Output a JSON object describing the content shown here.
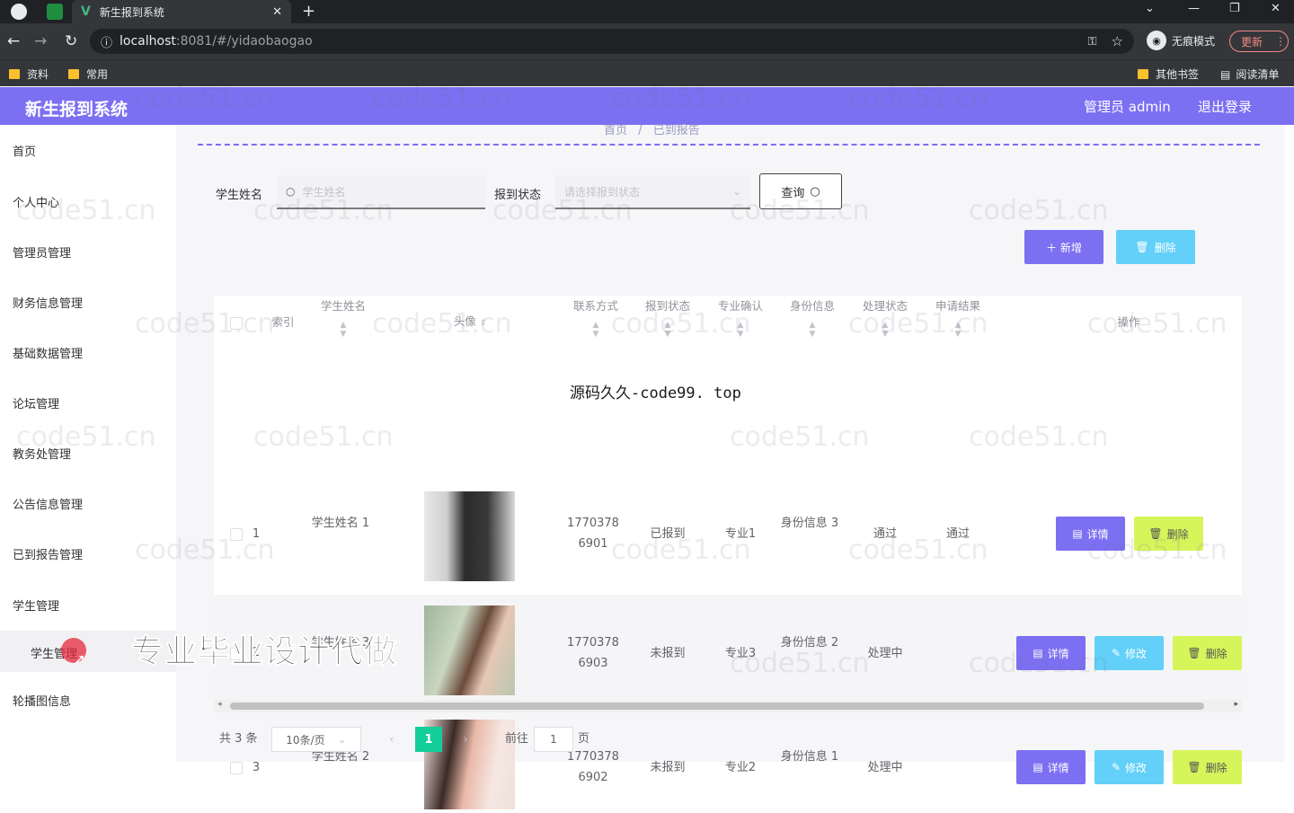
{
  "browser": {
    "tab_title": "新生报到系统",
    "tab_close": "✕",
    "new_tab": "+",
    "url_host": "localhost",
    "url_path": ":8081/#/yidaobaogao",
    "incognito_label": "无痕模式",
    "update_label": "更新",
    "bookmarks": [
      "资料",
      "常用"
    ],
    "other_bookmarks": "其他书签",
    "reading_list": "阅读清单"
  },
  "header": {
    "title": "新生报到系统",
    "user": "管理员 admin",
    "logout": "退出登录"
  },
  "sidebar": {
    "items": [
      "首页",
      "个人中心",
      "管理员管理",
      "财务信息管理",
      "基础数据管理",
      "论坛管理",
      "教务处管理",
      "公告信息管理",
      "已到报告管理",
      "学生管理"
    ],
    "submenu_active": "学生管理",
    "last_item": "轮播图信息"
  },
  "breadcrumb": {
    "home": "首页",
    "sep": "/",
    "current": "已到报告"
  },
  "search": {
    "name_label": "学生姓名",
    "name_placeholder": "学生姓名",
    "status_label": "报到状态",
    "status_placeholder": "请选择报到状态",
    "query_button": "查询"
  },
  "actions": {
    "add": "＋ 新增",
    "delete": "删除"
  },
  "table": {
    "headers": {
      "index": "索引",
      "name": "学生姓名",
      "avatar": "头像",
      "phone": "联系方式",
      "status": "报到状态",
      "major": "专业确认",
      "identity": "身份信息",
      "process": "处理状态",
      "result": "申请结果",
      "ops": "操作"
    },
    "rows": [
      {
        "index": "1",
        "name": "学生姓名 1",
        "phone": "1770378 6901",
        "status": "已报到",
        "major": "专业1",
        "identity": "身份信息 3",
        "process": "通过",
        "result": "通过"
      },
      {
        "index": "2",
        "name": "学生姓名 3",
        "phone": "1770378 6903",
        "status": "未报到",
        "major": "专业3",
        "identity": "身份信息 2",
        "process": "处理中",
        "result": ""
      },
      {
        "index": "3",
        "name": "学生姓名 2",
        "phone": "1770378 6902",
        "status": "未报到",
        "major": "专业2",
        "identity": "身份信息 1",
        "process": "处理中",
        "result": ""
      }
    ],
    "op_detail": "详情",
    "op_edit": "修改",
    "op_delete": "删除"
  },
  "pagination": {
    "total": "共 3 条",
    "page_size": "10条/页",
    "current_page": "1",
    "goto_prefix": "前往",
    "goto_value": "1",
    "goto_suffix": "页"
  },
  "overlays": {
    "source_text": "源码久久-code99. top",
    "promo_text": "专业毕业设计代做",
    "watermark": "code51.cn"
  },
  "colors": {
    "header": "#7b6ff2",
    "accent_cyan": "#62d0f8",
    "accent_lime": "#d6f55a",
    "pager_active": "#13ce9b"
  }
}
